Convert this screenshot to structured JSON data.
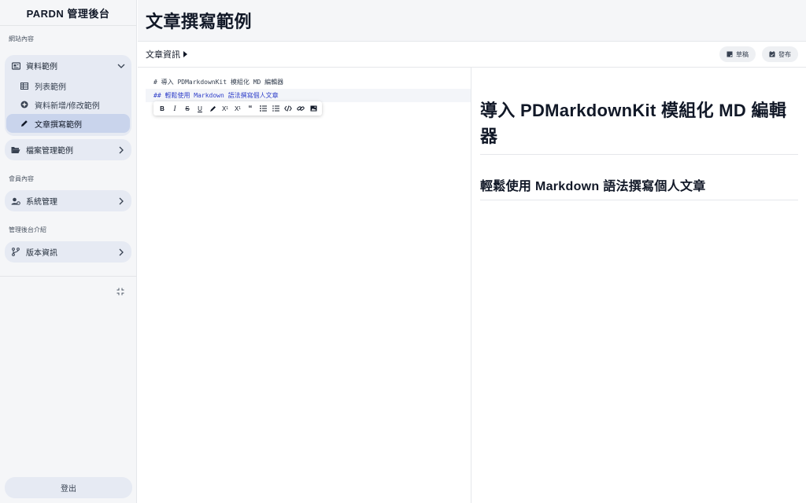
{
  "brand": "PARDN 管理後台",
  "sidebar": {
    "sections": [
      {
        "label": "網站內容"
      },
      {
        "label": "會員內容"
      },
      {
        "label": "管理後台介紹"
      }
    ],
    "groups": [
      {
        "label": "資料範例",
        "icon": "newspaper-icon",
        "expanded": true,
        "items": [
          {
            "label": "列表範例",
            "icon": "table-icon"
          },
          {
            "label": "資料新增/修改範例",
            "icon": "plus-circle-icon"
          },
          {
            "label": "文章撰寫範例",
            "icon": "pencil-icon",
            "active": true
          }
        ]
      },
      {
        "label": "檔案管理範例",
        "icon": "folder-open-icon",
        "expanded": false
      },
      {
        "label": "系統管理",
        "icon": "user-gear-icon",
        "expanded": false
      },
      {
        "label": "版本資訊",
        "icon": "code-branch-icon",
        "expanded": false
      }
    ],
    "logout": "登出"
  },
  "header": {
    "title": "文章撰寫範例"
  },
  "toolbar": {
    "info_label": "文章資訊",
    "draft_label": "草稿",
    "publish_label": "發布"
  },
  "editor": {
    "lines": [
      "# 導入 PDMarkdownKit 模組化 MD 編輯器",
      "## 輕鬆使用 Markdown 語法撰寫個人文章"
    ],
    "format_buttons": [
      "bold",
      "italic",
      "strikethrough",
      "underline",
      "highlight",
      "superscript",
      "subscript",
      "quote",
      "bullet-list",
      "ordered-list",
      "code",
      "link",
      "image"
    ]
  },
  "preview": {
    "h1": "導入 PDMarkdownKit 模組化 MD 編輯器",
    "h2": "輕鬆使用 Markdown 語法撰寫個人文章"
  },
  "colors": {
    "sidebar_bg": "#f5f6f8",
    "menu_bg": "#e6eaf3",
    "active_item": "#c9d4ec",
    "code_accent": "#2f3fc9"
  }
}
